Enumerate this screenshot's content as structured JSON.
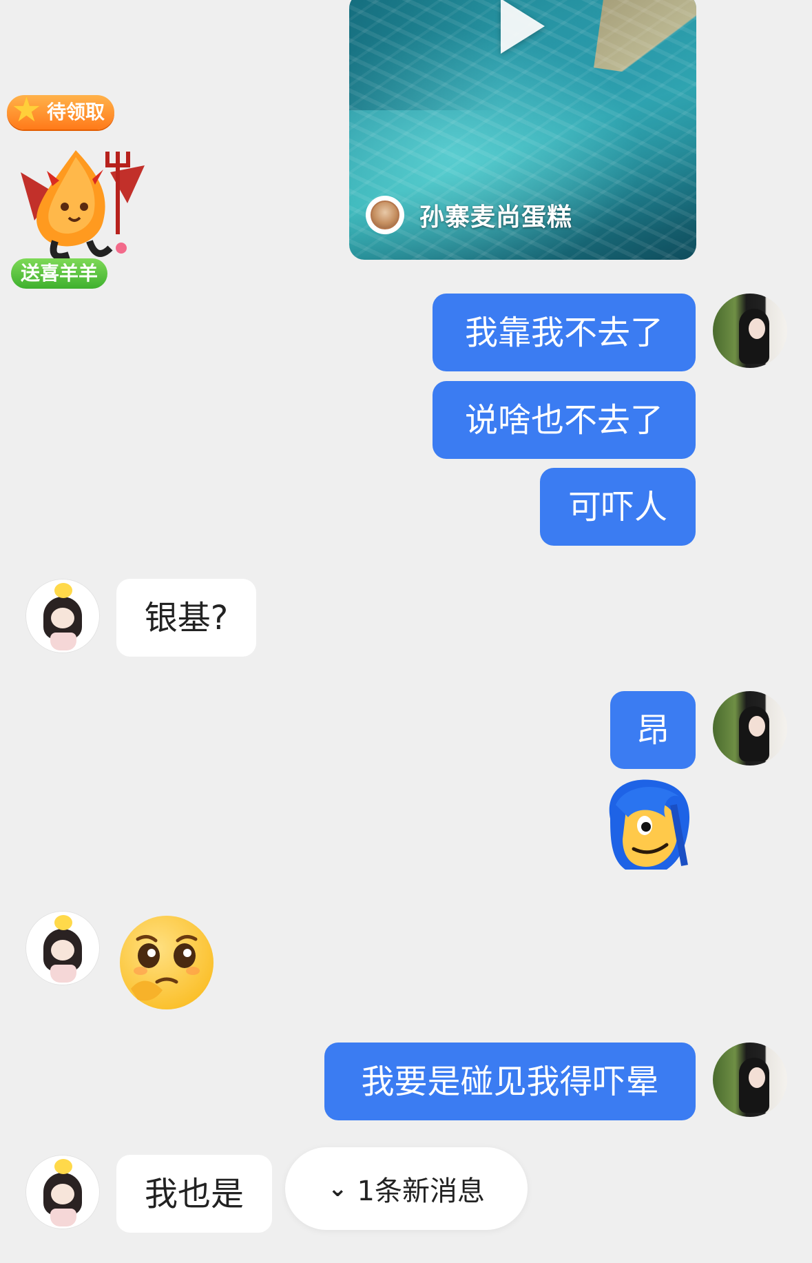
{
  "video_card": {
    "shop_name": "孙寨麦尚蛋糕",
    "icon": "play-icon"
  },
  "widget": {
    "claim_label": "待领取",
    "gift_label": "送喜羊羊",
    "icon": "star-icon"
  },
  "messages": [
    {
      "sender": "me",
      "text": "我靠我不去了"
    },
    {
      "sender": "me",
      "text": "说啥也不去了"
    },
    {
      "sender": "me",
      "text": "可吓人"
    },
    {
      "sender": "them",
      "text": "银基?"
    },
    {
      "sender": "me",
      "text": "昂"
    },
    {
      "sender": "me",
      "sticker": "blue-hair-smirk-sticker"
    },
    {
      "sender": "them",
      "sticker": "pleading-face-sticker"
    },
    {
      "sender": "me",
      "text": "我要是碰见我得吓晕"
    },
    {
      "sender": "them",
      "text": "我也是"
    }
  ],
  "new_message_pill": {
    "label": "1条新消息",
    "icon": "chevron-double-down-icon"
  },
  "colors": {
    "outgoing_bubble": "#3b7cf2",
    "incoming_bubble": "#ffffff",
    "background": "#efefef"
  }
}
